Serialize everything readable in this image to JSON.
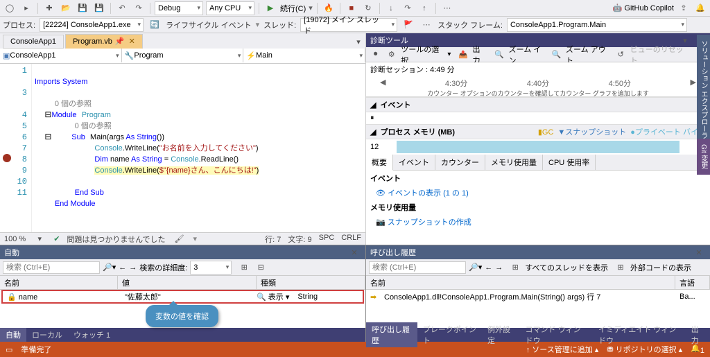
{
  "toolbar1": {
    "config": "Debug",
    "platform": "Any CPU",
    "run": "続行(C)",
    "copilot": "GitHub Copilot"
  },
  "toolbar2": {
    "process_lbl": "プロセス:",
    "process": "[22224] ConsoleApp1.exe",
    "lifecycle": "ライフサイクル イベント",
    "thread_lbl": "スレッド:",
    "thread": "[19072] メイン スレッド",
    "stack_lbl": "スタック フレーム:",
    "stack": "ConsoleApp1.Program.Main"
  },
  "tabs": {
    "t1": "ConsoleApp1",
    "t2": "Program.vb"
  },
  "nav": {
    "c1": "ConsoleApp1",
    "c2": "Program",
    "c3": "Main"
  },
  "code": {
    "l1": "Imports System",
    "ref0": "0 個の参照",
    "l3a": "Module",
    "l3b": "Program",
    "ref1": "0 個の参照",
    "l5a": "Sub",
    "l5b": "Main(args ",
    "l5c": "As String",
    "l5d": "())",
    "l6a": "Console",
    "l6b": ".WriteLine(",
    "l6c": "\"お名前を入力してください\"",
    "l6d": ")",
    "l7a": "Dim",
    "l7b": " name ",
    "l7c": "As String",
    "l7d": " = ",
    "l7e": "Console",
    "l7f": ".ReadLine()",
    "l8a": "Console",
    "l8b": ".WriteLine(",
    "l8c": "$\"{name}さん、こんにちは!\"",
    "l8d": ")",
    "l9": "End Sub",
    "l10": "End Module"
  },
  "ed_status": {
    "pct": "100 %",
    "ok": "問題は見つかりませんでした",
    "line": "行: 7",
    "col": "文字: 9",
    "spc": "SPC",
    "crlf": "CRLF"
  },
  "diag": {
    "title": "診断ツール",
    "tool_select": "ツールの選択",
    "zoom_in": "ズーム イン",
    "zoom_out": "ズーム アウト",
    "reset_view": "ビューのリセット",
    "output": "出力",
    "session": "診断セッション : 4:49 分",
    "t1": "4:30分",
    "t2": "4:40分",
    "t3": "4:50分",
    "counter_msg": "カウンター オプションのカウンターを確認してカウンター グラフを追加します",
    "events_hdr": "イベント",
    "mem_hdr": "プロセス メモリ (MB)",
    "gc": "GC",
    "snap": "スナップショット",
    "priv": "プライベート バイト",
    "mem_val": "12",
    "tabs": [
      "概要",
      "イベント",
      "カウンター",
      "メモリ使用量",
      "CPU 使用率"
    ],
    "events2": "イベント",
    "ev_show": "イベントの表示 (1 の 1)",
    "mem2": "メモリ使用量",
    "snap2": "スナップショットの作成"
  },
  "autos": {
    "title": "自動",
    "search_ph": "検索 (Ctrl+E)",
    "depth_lbl": "検索の詳細度:",
    "depth": "3",
    "hdr_name": "名前",
    "hdr_val": "値",
    "hdr_type": "種類",
    "var_name": "name",
    "var_val": "\"佐藤太郎\"",
    "var_view": "表示",
    "var_type": "String",
    "callout": "変数の値を確認",
    "btabs": [
      "自動",
      "ローカル",
      "ウォッチ 1"
    ]
  },
  "callstack": {
    "title": "呼び出し履歴",
    "search_ph": "検索 (Ctrl+E)",
    "all_threads": "すべてのスレッドを表示",
    "ext_code": "外部コードの表示",
    "hdr_name": "名前",
    "hdr_lang": "言語",
    "row1": "ConsoleApp1.dll!ConsoleApp1.Program.Main(String() args) 行 7",
    "lang1": "Ba...",
    "btabs": [
      "呼び出し履歴",
      "ブレークポイント",
      "例外設定",
      "コマンド ウィンドウ",
      "イミディエイト ウィンドウ",
      "出力"
    ]
  },
  "status": {
    "ready": "準備完了",
    "src_ctrl": "ソース管理に追加",
    "repo": "リポジトリの選択",
    "bell": "1"
  },
  "sidebar": {
    "sol": "ソリューション エクスプローラー",
    "git": "Git 変更"
  }
}
